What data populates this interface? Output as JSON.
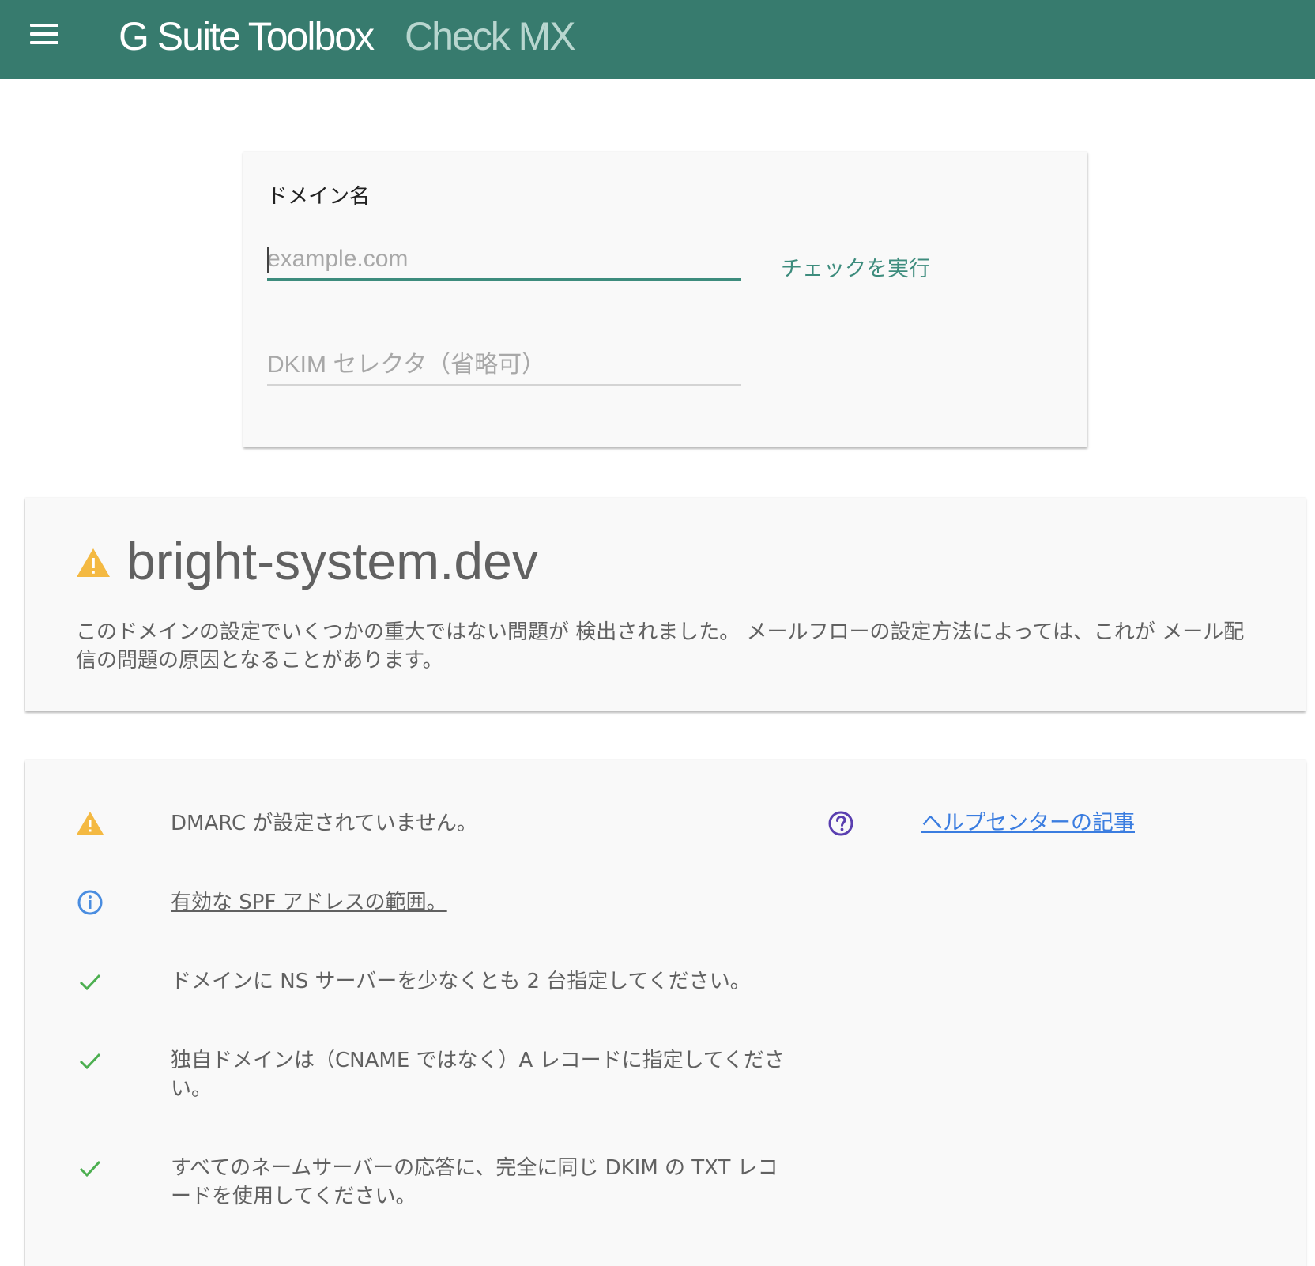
{
  "header": {
    "app_title": "G Suite Toolbox",
    "app_subtitle": "Check MX"
  },
  "form": {
    "domain_label": "ドメイン名",
    "domain_placeholder": "example.com",
    "domain_value": "",
    "dkim_placeholder": "DKIM セレクタ（省略可）",
    "dkim_value": "",
    "check_button": "チェックを実行"
  },
  "summary": {
    "domain": "bright-system.dev",
    "status_icon": "warning-icon",
    "message": "このドメインの設定でいくつかの重大ではない問題が 検出されました。 メールフローの設定方法によっては、これが メール配信の問題の原因となることがあります。"
  },
  "results": [
    {
      "status": "warning",
      "icon": "warning-icon",
      "message": "DMARC が設定されていません。",
      "help_icon": "help-circle-icon",
      "help_link": "ヘルプセンターの記事"
    },
    {
      "status": "info",
      "icon": "info-icon",
      "message": "有効な SPF アドレスの範囲。",
      "is_link": true
    },
    {
      "status": "ok",
      "icon": "check-icon",
      "message": "ドメインに NS サーバーを少なくとも 2 台指定してください。"
    },
    {
      "status": "ok",
      "icon": "check-icon",
      "message": "独自ドメインは（CNAME ではなく）A レコードに指定してください。"
    },
    {
      "status": "ok",
      "icon": "check-icon",
      "message": "すべてのネームサーバーの応答に、完全に同じ DKIM の TXT レコードを使用してください。"
    }
  ],
  "colors": {
    "header_bg": "#377b6e",
    "accent": "#3d8c7d",
    "warning": "#f4b942",
    "info": "#4a8de0",
    "ok": "#4caf50",
    "help": "#5a3fb0",
    "link": "#3b7de0"
  }
}
